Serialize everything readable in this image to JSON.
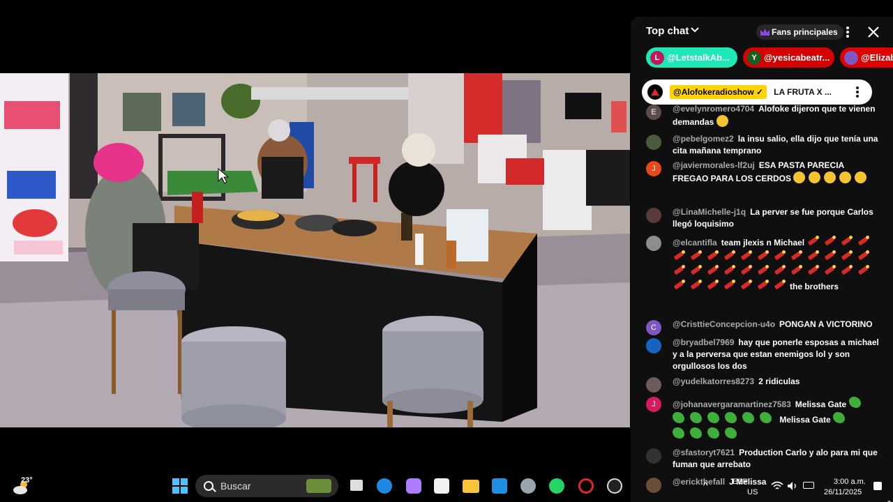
{
  "chat": {
    "title": "Top chat",
    "fans_label": "Fans principales",
    "tickers": [
      {
        "initial": "L",
        "name": "@LetstalkAb...",
        "bg": "#1de9b6",
        "avatar_bg": "#c2185b"
      },
      {
        "initial": "Y",
        "name": "@yesicabeatr...",
        "bg": "#d50000",
        "avatar_bg": "#1b5e20"
      },
      {
        "initial": "",
        "name": "@Elizab",
        "bg": "#e00000",
        "avatar_bg": "#7e57c2"
      }
    ],
    "pinned": {
      "name": "@Alofokeradioshow ✓",
      "message": "LA FRUTA X ..."
    },
    "messages": [
      {
        "user": "@evelynromero4704",
        "text": "Alofoke dijeron que te vienen demandas",
        "avatar_letter": "E",
        "avatar_bg": "#5d4b4b",
        "emoji": "smile"
      },
      {
        "user": "@pebelgomez2",
        "text": "la insu salio, ella dijo que tenía una cita mañana temprano",
        "avatar_letter": "",
        "avatar_bg": "#4a5a3a"
      },
      {
        "user": "@javiermorales-lf2uj",
        "text": "ESA PASTA PARECIA FREGAO PARA LOS CERDOS",
        "avatar_letter": "J",
        "avatar_bg": "#e64a19",
        "emoji": "laugh"
      },
      {
        "user": "@LinaMichelle-j1q",
        "text": "La perver se fue porque Carlos llegó loquisimo",
        "avatar_letter": "",
        "avatar_bg": "#5a3a3a"
      },
      {
        "user": "@elcantifla",
        "text": "team jlexis n Michael",
        "avatar_letter": "",
        "avatar_bg": "#8d8d8d",
        "tail": "the brothers"
      },
      {
        "user": "@CristtieConcepcion-u4o",
        "text": "PONGAN A VICTORINO",
        "avatar_letter": "C",
        "avatar_bg": "#7e57c2"
      },
      {
        "user": "@bryadbel7969",
        "text": "hay que ponerle esposas a michael y a la perversa que estan enemigos lol y son orgullosos los dos",
        "avatar_letter": "",
        "avatar_bg": "#1565c0"
      },
      {
        "user": "@yudelkatorres8273",
        "text": "2 ridiculas",
        "avatar_letter": "",
        "avatar_bg": "#6d5a5a"
      },
      {
        "user": "@johanavergaramartinez7583",
        "text": "Melissa Gate",
        "avatar_letter": "J",
        "avatar_bg": "#d81b60",
        "tail": "Melissa Gate"
      },
      {
        "user": "@sfastoryt7621",
        "text": "Production Carlo y alo para mi que fuman que arrebato",
        "avatar_letter": "",
        "avatar_bg": "#333333"
      },
      {
        "user": "@erickthefall",
        "text": "J Melissa",
        "avatar_letter": "",
        "avatar_bg": "#6b4e3a"
      }
    ]
  },
  "taskbar": {
    "temperature": "23°",
    "search_placeholder": "Buscar",
    "language_top": "ESP",
    "language_bottom": "US",
    "time": "3:00 a.m.",
    "date": "26/11/2025"
  }
}
